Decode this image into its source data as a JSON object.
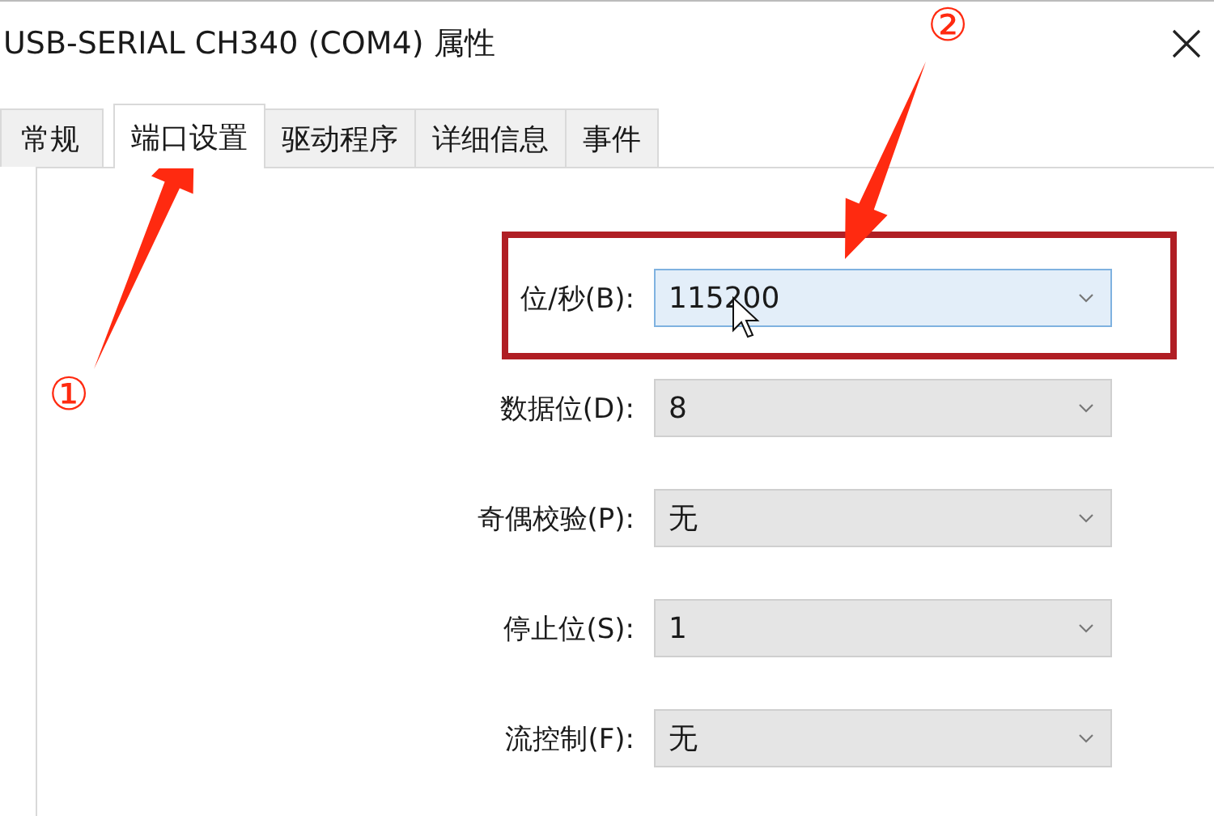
{
  "window": {
    "title": "USB-SERIAL CH340 (COM4) 属性"
  },
  "tabs": [
    {
      "label": "常规",
      "selected": false
    },
    {
      "label": "端口设置",
      "selected": true
    },
    {
      "label": "驱动程序",
      "selected": false
    },
    {
      "label": "详细信息",
      "selected": false
    },
    {
      "label": "事件",
      "selected": false
    }
  ],
  "fields": [
    {
      "label": "位/秒(B):",
      "value": "115200",
      "focused": true
    },
    {
      "label": "数据位(D):",
      "value": "8",
      "focused": false
    },
    {
      "label": "奇偶校验(P):",
      "value": "无",
      "focused": false
    },
    {
      "label": "停止位(S):",
      "value": "1",
      "focused": false
    },
    {
      "label": "流控制(F):",
      "value": "无",
      "focused": false
    }
  ],
  "annotations": {
    "markers": [
      "①",
      "②"
    ]
  }
}
